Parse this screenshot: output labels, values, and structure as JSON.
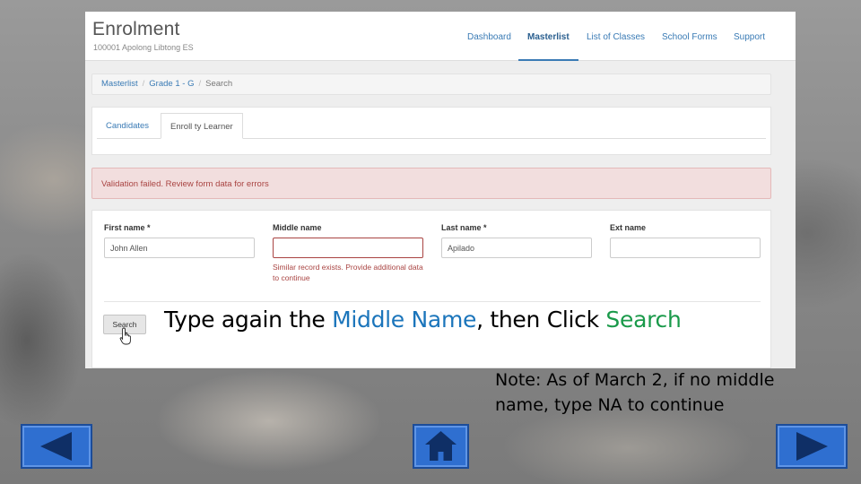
{
  "app": {
    "title": "Enrolment",
    "subtitle": "100001  Apolong Libtong ES"
  },
  "nav": {
    "items": [
      {
        "label": "Dashboard"
      },
      {
        "label": "Masterlist"
      },
      {
        "label": "List of Classes"
      },
      {
        "label": "School Forms"
      },
      {
        "label": "Support"
      }
    ],
    "active": "Masterlist"
  },
  "breadcrumb": {
    "items": [
      "Masterlist",
      "Grade 1 - G",
      "Search"
    ]
  },
  "tabs": {
    "items": [
      {
        "label": "Candidates"
      },
      {
        "label": "Enroll ty Learner"
      }
    ],
    "active": "Enroll ty Learner"
  },
  "alert": {
    "message": "Validation failed. Review form data for errors"
  },
  "form": {
    "first_name": {
      "label": "First name *",
      "value": "John Allen"
    },
    "middle_name": {
      "label": "Middle name",
      "value": "",
      "help": "Similar record exists. Provide additional data to continue"
    },
    "last_name": {
      "label": "Last name *",
      "value": "Apilado"
    },
    "ext_name": {
      "label": "Ext name",
      "value": ""
    },
    "search_label": "Search"
  },
  "instruction": {
    "part1": "Type again the ",
    "highlight1": "Middle Name",
    "part2": ", then Click ",
    "highlight2": "Search"
  },
  "note": {
    "text": "Note: As of March 2, if no middle name, type NA to continue"
  },
  "colors": {
    "accent": "#1b75bb",
    "highlight_green": "#1a9a4a",
    "error": "#a94442",
    "nav_button": "#2f6fd0"
  },
  "icons": {
    "back": "triangle-left-icon",
    "home": "house-icon",
    "forward": "triangle-right-icon"
  }
}
